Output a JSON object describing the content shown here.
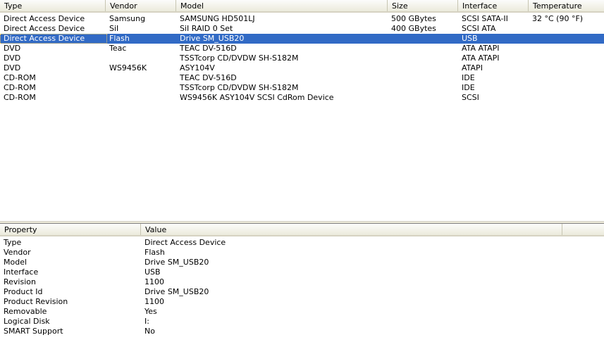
{
  "devices": {
    "columns": [
      "Type",
      "Vendor",
      "Model",
      "Size",
      "Interface",
      "Temperature"
    ],
    "rows": [
      [
        "Direct Access Device",
        "Samsung",
        "SAMSUNG HD501LJ",
        "500 GBytes",
        "SCSI SATA-II",
        "32 °C (90 °F)"
      ],
      [
        "Direct Access Device",
        "SiI",
        "SiI RAID 0 Set",
        "400 GBytes",
        "SCSI ATA",
        ""
      ],
      [
        "Direct Access Device",
        "Flash",
        "Drive SM_USB20",
        "",
        "USB",
        ""
      ],
      [
        "DVD",
        "Teac",
        "TEAC DV-516D",
        "",
        "ATA ATAPI",
        ""
      ],
      [
        "DVD",
        "",
        "TSSTcorp CD/DVDW SH-S182M",
        "",
        "ATA ATAPI",
        ""
      ],
      [
        "DVD",
        "WS9456K",
        "ASY104V",
        "",
        "ATAPI",
        ""
      ],
      [
        "CD-ROM",
        "",
        "TEAC DV-516D",
        "",
        "IDE",
        ""
      ],
      [
        "CD-ROM",
        "",
        "TSSTcorp CD/DVDW SH-S182M",
        "",
        "IDE",
        ""
      ],
      [
        "CD-ROM",
        "",
        "WS9456K ASY104V SCSI CdRom Device",
        "",
        "SCSI",
        ""
      ]
    ],
    "selected_row": 2
  },
  "properties": {
    "columns": [
      "Property",
      "Value"
    ],
    "rows": [
      [
        "Type",
        "Direct Access Device"
      ],
      [
        "Vendor",
        "Flash"
      ],
      [
        "Model",
        "Drive SM_USB20"
      ],
      [
        "Interface",
        "USB"
      ],
      [
        "Revision",
        "1100"
      ],
      [
        "Product Id",
        "Drive SM_USB20"
      ],
      [
        "Product Revision",
        "1100"
      ],
      [
        "Removable",
        "Yes"
      ],
      [
        "Logical Disk",
        "I:"
      ],
      [
        "SMART Support",
        "No"
      ]
    ]
  },
  "colors": {
    "selection": "#316ac5",
    "header_bg": "#ebeadb",
    "window_bg": "#ffffff"
  }
}
